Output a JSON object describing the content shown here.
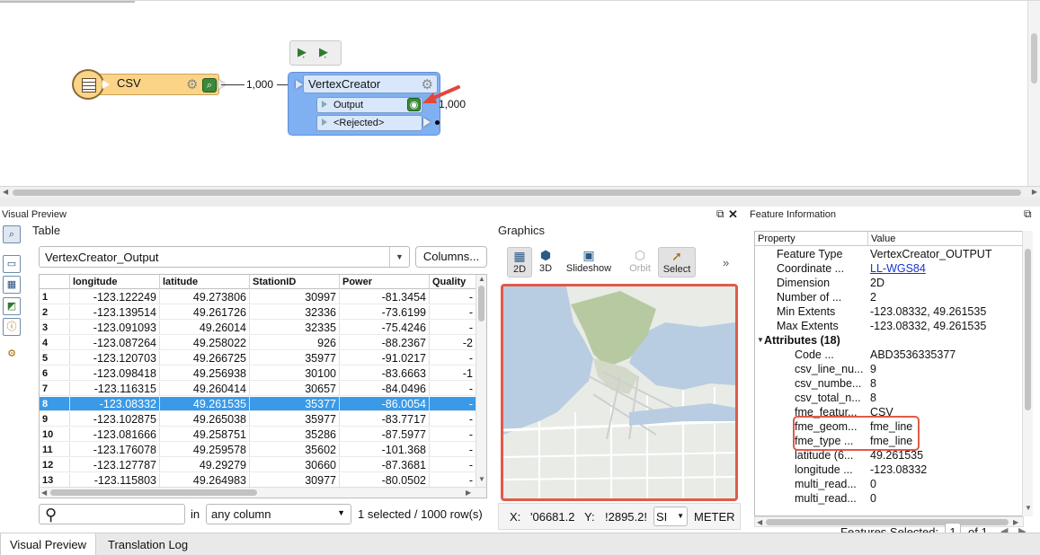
{
  "canvas": {
    "csv_node": {
      "title": "CSV"
    },
    "csv_count": "1,000",
    "vertex_node": {
      "title": "VertexCreator",
      "ports": [
        "Output",
        "<Rejected>"
      ]
    },
    "output_count": "1,000"
  },
  "visual_preview": {
    "panel_title": "Visual Preview",
    "table_section": "Table",
    "dataset": "VertexCreator_Output",
    "columns_button": "Columns...",
    "columns": [
      "longitude",
      "latitude",
      "StationID",
      "Power",
      "Quality"
    ],
    "rows": [
      [
        "1",
        "-123.122249",
        "49.273806",
        "30997",
        "-81.3454",
        "-"
      ],
      [
        "2",
        "-123.139514",
        "49.261726",
        "32336",
        "-73.6199",
        "-"
      ],
      [
        "3",
        "-123.091093",
        "49.26014",
        "32335",
        "-75.4246",
        "-"
      ],
      [
        "4",
        "-123.087264",
        "49.258022",
        "926",
        "-88.2367",
        "-2"
      ],
      [
        "5",
        "-123.120703",
        "49.266725",
        "35977",
        "-91.0217",
        "-"
      ],
      [
        "6",
        "-123.098418",
        "49.256938",
        "30100",
        "-83.6663",
        "-1"
      ],
      [
        "7",
        "-123.116315",
        "49.260414",
        "30657",
        "-84.0496",
        "-"
      ],
      [
        "8",
        "-123.08332",
        "49.261535",
        "35377",
        "-86.0054",
        "-"
      ],
      [
        "9",
        "-123.102875",
        "49.265038",
        "35977",
        "-83.7717",
        "-"
      ],
      [
        "10",
        "-123.081666",
        "49.258751",
        "35286",
        "-87.5977",
        "-"
      ],
      [
        "11",
        "-123.176078",
        "49.259578",
        "35602",
        "-101.368",
        "-"
      ],
      [
        "12",
        "-123.127787",
        "49.29279",
        "30660",
        "-87.3681",
        "-"
      ],
      [
        "13",
        "-123.115803",
        "49.264983",
        "30977",
        "-80.0502",
        "-"
      ]
    ],
    "selected_row": 8,
    "search_in_label": "in",
    "search_scope": "any column",
    "status": "1 selected / 1000 row(s)"
  },
  "graphics": {
    "title": "Graphics",
    "tools": [
      "2D",
      "3D",
      "Slideshow",
      "Orbit",
      "Select"
    ],
    "overflow": "»",
    "x_label": "X:",
    "x_value": "'06681.2",
    "y_label": "Y:",
    "y_value": "!2895.2!",
    "srs": "SI",
    "unit": "METER"
  },
  "feature_info": {
    "title": "Feature Information",
    "col_property": "Property",
    "col_value": "Value",
    "rows": [
      {
        "p": "Feature Type",
        "v": "VertexCreator_OUTPUT",
        "indent": 1
      },
      {
        "p": "Coordinate ...",
        "v": "LL-WGS84",
        "indent": 1,
        "link": true
      },
      {
        "p": "Dimension",
        "v": "2D",
        "indent": 1
      },
      {
        "p": "Number of ...",
        "v": "2",
        "indent": 1
      },
      {
        "p": "Min Extents",
        "v": "-123.08332, 49.261535",
        "indent": 1
      },
      {
        "p": "Max Extents",
        "v": "-123.08332, 49.261535",
        "indent": 1
      },
      {
        "p": "Attributes (18)",
        "v": "",
        "indent": 0,
        "bold": true
      },
      {
        "p": "Code ...",
        "v": "ABD3536335377",
        "indent": 2
      },
      {
        "p": "csv_line_nu...",
        "v": "9",
        "indent": 2
      },
      {
        "p": "csv_numbe...",
        "v": "8",
        "indent": 2
      },
      {
        "p": "csv_total_n...",
        "v": "8",
        "indent": 2
      },
      {
        "p": "fme_featur...",
        "v": "CSV",
        "indent": 2
      },
      {
        "p": "fme_geom...",
        "v": "fme_line",
        "indent": 2
      },
      {
        "p": "fme_type ...",
        "v": "fme_line",
        "indent": 2
      },
      {
        "p": "latitude (6...",
        "v": "49.261535",
        "indent": 2
      },
      {
        "p": "longitude ...",
        "v": "-123.08332",
        "indent": 2
      },
      {
        "p": "multi_read...",
        "v": "0",
        "indent": 2
      },
      {
        "p": "multi_read...",
        "v": "0",
        "indent": 2
      }
    ],
    "features_selected_label": "Features Selected:",
    "features_selected_value": "1",
    "of_label": "of 1"
  },
  "bottom_tabs": [
    "Visual Preview",
    "Translation Log"
  ]
}
